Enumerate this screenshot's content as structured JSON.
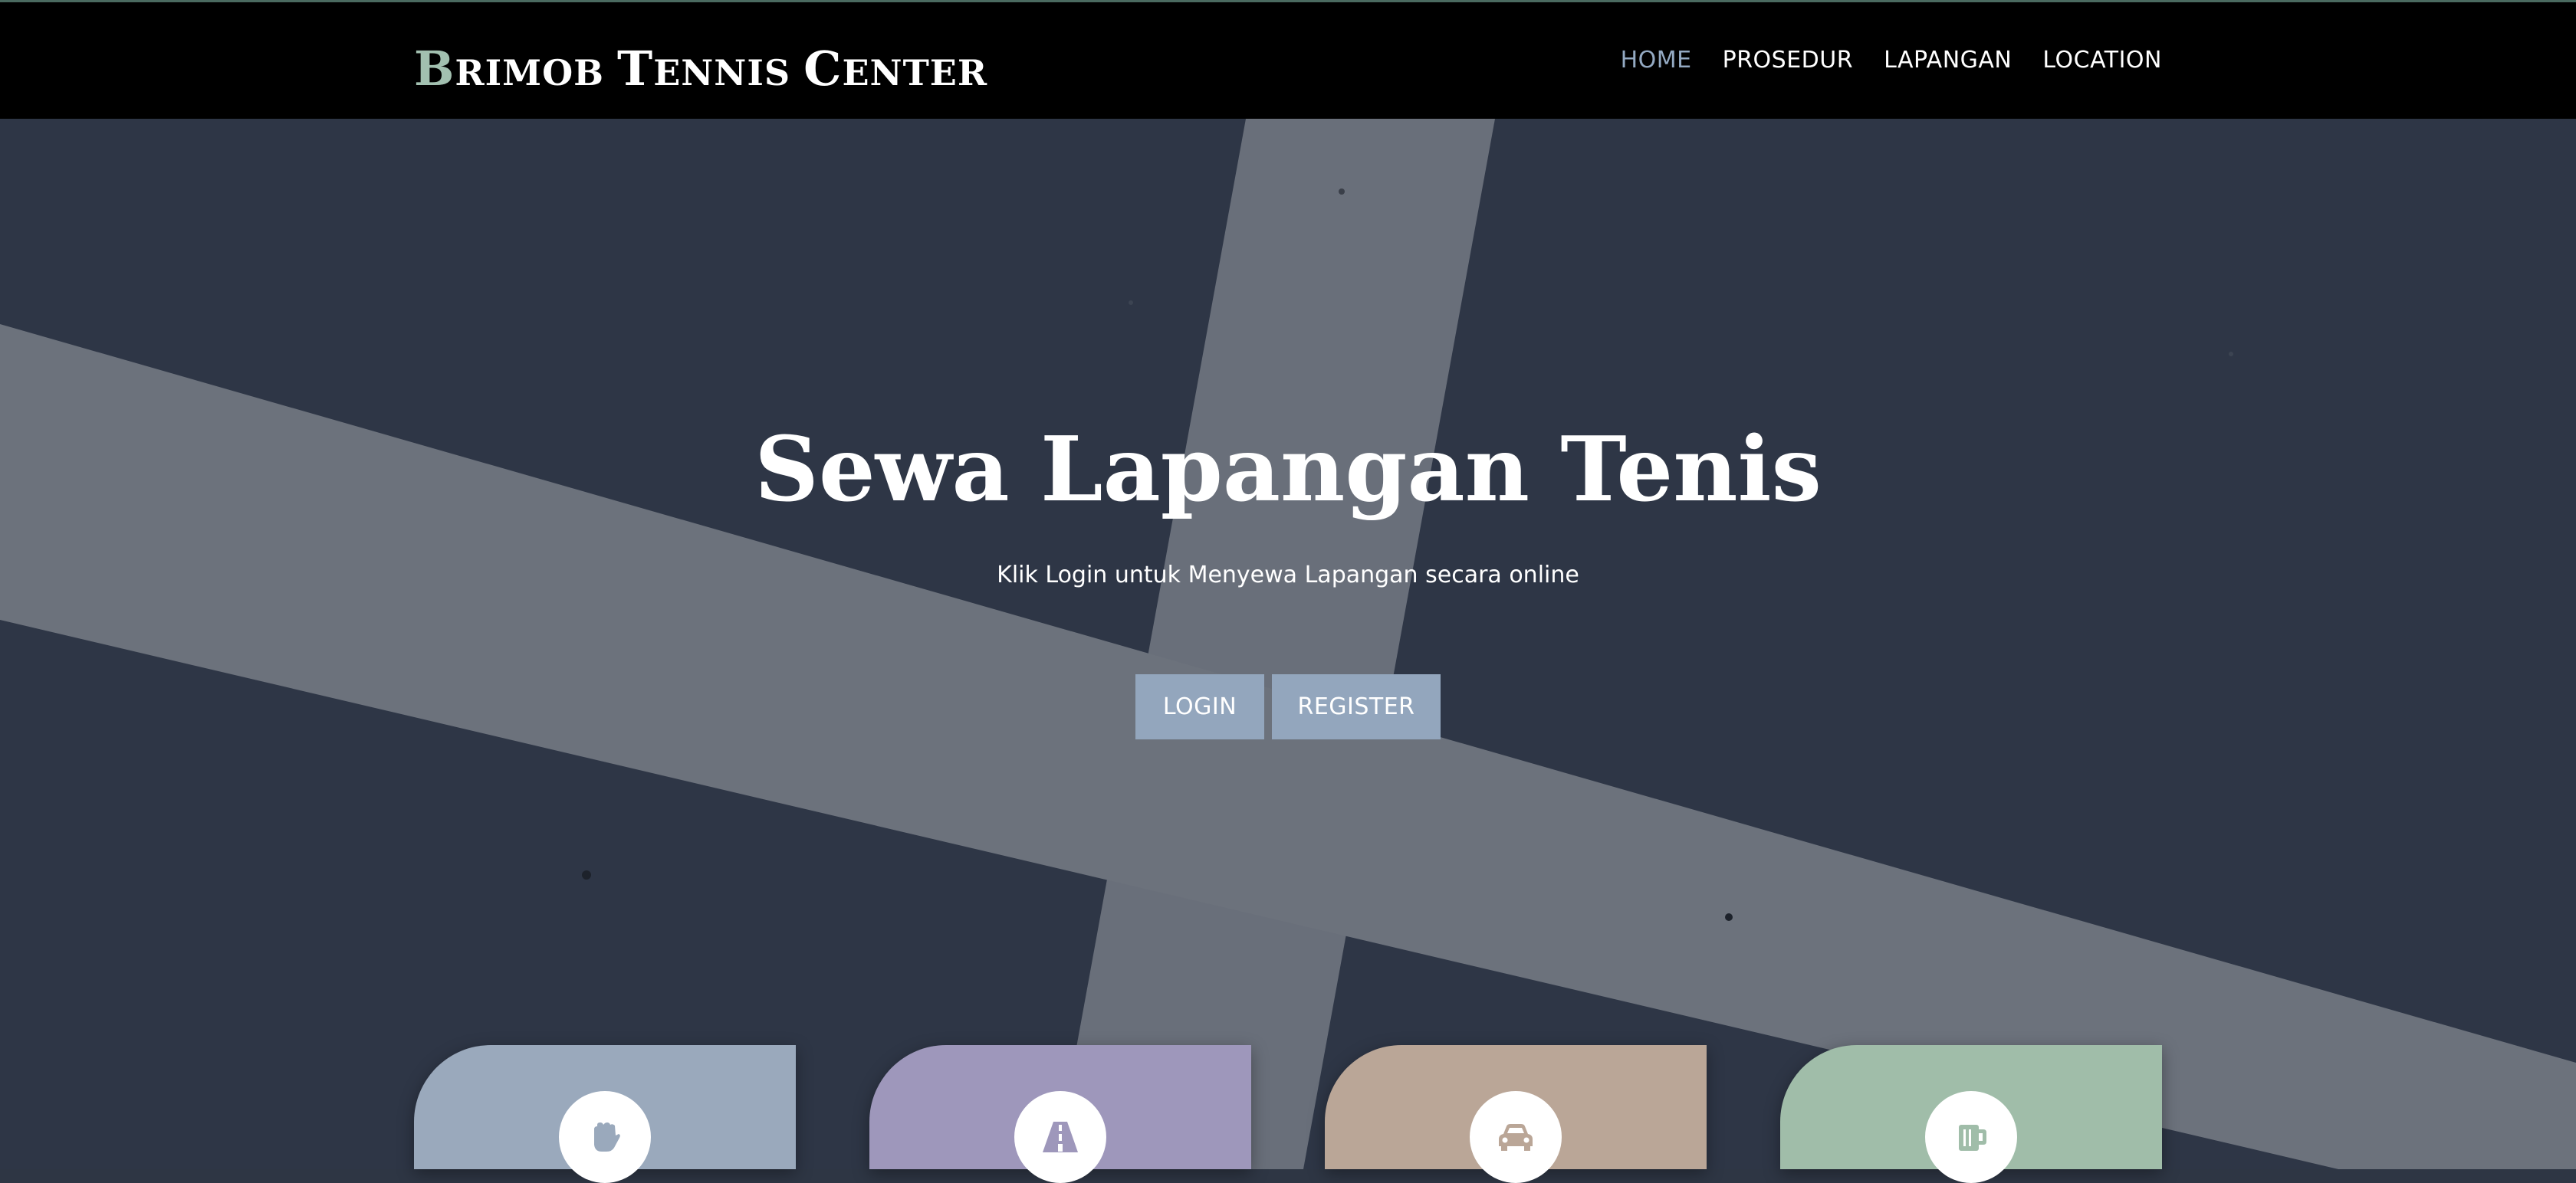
{
  "navbar": {
    "brand": {
      "word1_initial": "B",
      "word1_rest": "RIMOB",
      "word2_initial": "T",
      "word2_rest": "ENNIS",
      "word3_initial": "C",
      "word3_rest": "ENTER"
    },
    "links": [
      {
        "label": "HOME",
        "active": true
      },
      {
        "label": "PROSEDUR",
        "active": false
      },
      {
        "label": "LAPANGAN",
        "active": false
      },
      {
        "label": "LOCATION",
        "active": false
      }
    ]
  },
  "hero": {
    "title": "Sewa Lapangan Tenis",
    "subtitle": "Klik Login untuk Menyewa Lapangan secara online",
    "login_label": "LOGIN",
    "register_label": "REGISTER"
  },
  "cards": [
    {
      "icon": "glove-icon",
      "color": "#9aa9bc"
    },
    {
      "icon": "road-icon",
      "color": "#9e97bb"
    },
    {
      "icon": "car-icon",
      "color": "#baa697"
    },
    {
      "icon": "mug-icon",
      "color": "#a0bda9"
    }
  ],
  "colors": {
    "navbar_bg": "#000000",
    "active_link": "#93a9c2",
    "button_bg": "#93a6bd",
    "hero_bg": "#2d3545"
  }
}
